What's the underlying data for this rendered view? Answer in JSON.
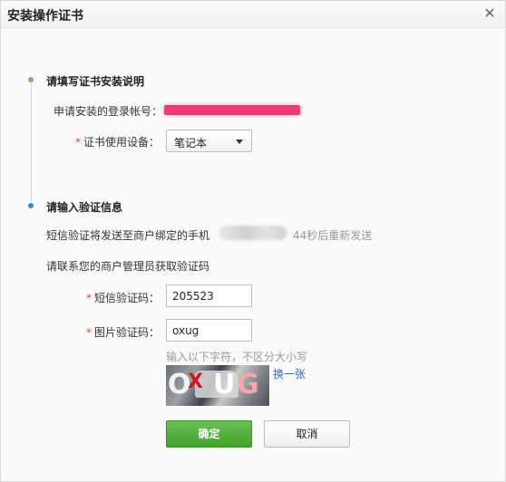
{
  "dialog": {
    "title": "安装操作证书",
    "close_glyph": "✕"
  },
  "step1": {
    "title": "请填写证书安装说明",
    "account_label": "申请安装的登录帐号：",
    "device_label": "证书使用设备：",
    "device_value": "笔记本",
    "required_mark": "*"
  },
  "step2": {
    "title": "请输入验证信息",
    "sms_sent_text": "短信验证将发送至商户绑定的手机",
    "resend_text": "44秒后重新发送",
    "contact_text": "请联系您的商户管理员获取验证码",
    "sms_code_label": "短信验证码：",
    "sms_code_value": "205523",
    "image_code_label": "图片验证码：",
    "image_code_value": "oxug",
    "hint": "输入以下字符，不区分大小写",
    "captcha_chars": [
      "O",
      "X",
      "U",
      "G"
    ],
    "refresh_label": "换一张",
    "required_mark": "*"
  },
  "buttons": {
    "confirm": "确定",
    "cancel": "取消"
  },
  "colors": {
    "step1_dot": "#77b65e",
    "step2_dot": "#3a87c8",
    "primary_button": "#4caf35",
    "link": "#2d6db5",
    "required": "#e0413b",
    "redaction": "#ea3a78"
  },
  "icons": {
    "close": "close-icon",
    "dropdown": "chevron-down-icon"
  }
}
